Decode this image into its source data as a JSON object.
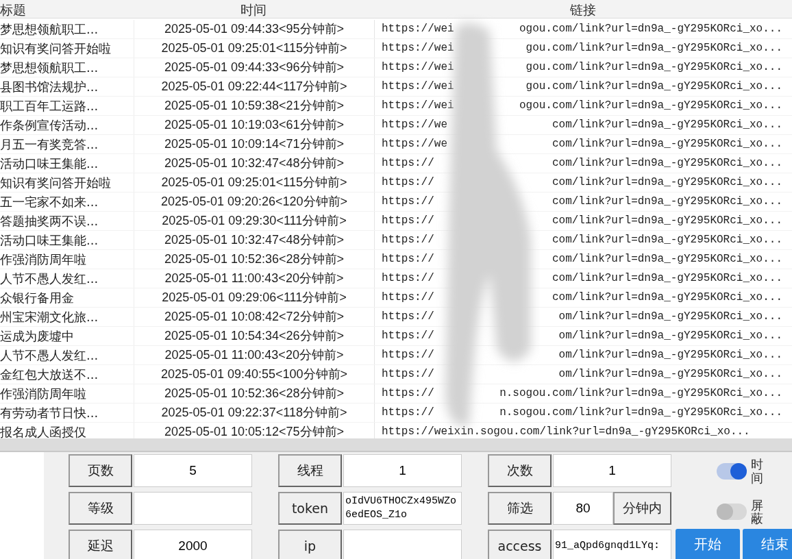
{
  "table": {
    "columns": [
      "标题",
      "时间",
      "链接"
    ],
    "rows": [
      {
        "title": "梦思想领航职工...",
        "time": "2025-05-01 09:44:33<95分钟前>",
        "link_start": "https://wei",
        "link_end": "ogou.com/link?url=dn9a_-gY295KORci_xo..."
      },
      {
        "title": "知识有奖问答开始啦",
        "time": "2025-05-01 09:25:01<115分钟前>",
        "link_start": "https://wei",
        "link_end": "gou.com/link?url=dn9a_-gY295KORci_xo..."
      },
      {
        "title": "梦思想领航职工...",
        "time": "2025-05-01 09:44:33<96分钟前>",
        "link_start": "https://wei",
        "link_end": "gou.com/link?url=dn9a_-gY295KORci_xo..."
      },
      {
        "title": "县图书馆法规护...",
        "time": "2025-05-01 09:22:44<117分钟前>",
        "link_start": "https://wei",
        "link_end": "gou.com/link?url=dn9a_-gY295KORci_xo..."
      },
      {
        "title": "职工百年工运路...",
        "time": "2025-05-01 10:59:38<21分钟前>",
        "link_start": "https://wei",
        "link_end": "ogou.com/link?url=dn9a_-gY295KORci_xo..."
      },
      {
        "title": "作条例宣传活动...",
        "time": "2025-05-01 10:19:03<61分钟前>",
        "link_start": "https://we",
        "link_end": "com/link?url=dn9a_-gY295KORci_xo..."
      },
      {
        "title": "月五一有奖竞答...",
        "time": "2025-05-01 10:09:14<71分钟前>",
        "link_start": "https://we",
        "link_end": "com/link?url=dn9a_-gY295KORci_xo..."
      },
      {
        "title": "活动口味王集能...",
        "time": "2025-05-01 10:32:47<48分钟前>",
        "link_start": "https://",
        "link_end": "com/link?url=dn9a_-gY295KORci_xo..."
      },
      {
        "title": "知识有奖问答开始啦",
        "time": "2025-05-01 09:25:01<115分钟前>",
        "link_start": "https://",
        "link_end": "com/link?url=dn9a_-gY295KORci_xo..."
      },
      {
        "title": "五一宅家不如来...",
        "time": "2025-05-01 09:20:26<120分钟前>",
        "link_start": "https://",
        "link_end": "com/link?url=dn9a_-gY295KORci_xo..."
      },
      {
        "title": "答题抽奖两不误...",
        "time": "2025-05-01 09:29:30<111分钟前>",
        "link_start": "https://",
        "link_end": "com/link?url=dn9a_-gY295KORci_xo..."
      },
      {
        "title": "活动口味王集能...",
        "time": "2025-05-01 10:32:47<48分钟前>",
        "link_start": "https://",
        "link_end": "com/link?url=dn9a_-gY295KORci_xo..."
      },
      {
        "title": "作强消防周年啦",
        "time": "2025-05-01 10:52:36<28分钟前>",
        "link_start": "https://",
        "link_end": "com/link?url=dn9a_-gY295KORci_xo..."
      },
      {
        "title": "人节不愚人发红...",
        "time": "2025-05-01 11:00:43<20分钟前>",
        "link_start": "https://",
        "link_end": "com/link?url=dn9a_-gY295KORci_xo..."
      },
      {
        "title": "众银行备用金",
        "time": "2025-05-01 09:29:06<111分钟前>",
        "link_start": "https://",
        "link_end": "com/link?url=dn9a_-gY295KORci_xo..."
      },
      {
        "title": "州宝宋潮文化旅...",
        "time": "2025-05-01 10:08:42<72分钟前>",
        "link_start": "https://",
        "link_end": "om/link?url=dn9a_-gY295KORci_xo..."
      },
      {
        "title": "运成为废墟中",
        "time": "2025-05-01 10:54:34<26分钟前>",
        "link_start": "https://",
        "link_end": "om/link?url=dn9a_-gY295KORci_xo..."
      },
      {
        "title": "人节不愚人发红...",
        "time": "2025-05-01 11:00:43<20分钟前>",
        "link_start": "https://",
        "link_end": "om/link?url=dn9a_-gY295KORci_xo..."
      },
      {
        "title": "金红包大放送不...",
        "time": "2025-05-01 09:40:55<100分钟前>",
        "link_start": "https://",
        "link_end": "om/link?url=dn9a_-gY295KORci_xo..."
      },
      {
        "title": "作强消防周年啦",
        "time": "2025-05-01 10:52:36<28分钟前>",
        "link_start": "https://",
        "link_end": "n.sogou.com/link?url=dn9a_-gY295KORci_xo..."
      },
      {
        "title": "有劳动者节日快...",
        "time": "2025-05-01 09:22:37<118分钟前>",
        "link_start": "https://",
        "link_end": "n.sogou.com/link?url=dn9a_-gY295KORci_xo..."
      },
      {
        "title": "报名成人函授仅",
        "time": "2025-05-01 10:05:12<75分钟前>",
        "link_start": "https://weixin.sogou.com/link?url=dn9a_-gY295KORci_xo..."
      }
    ]
  },
  "settings": [
    [
      {
        "label": "页数",
        "value": "5"
      },
      {
        "label": "线程",
        "value": "1"
      },
      {
        "label": "次数",
        "value": "1"
      }
    ],
    [
      {
        "label": "等级"
      },
      {
        "label": "token",
        "value": "oIdVU6THOCZx495WZo6edEOS_Z1o"
      },
      {
        "label": "筛选",
        "value": "80",
        "unit": "分钟内"
      }
    ],
    [
      {
        "label": "延迟",
        "value": "2000"
      },
      {
        "label": "ip"
      },
      {
        "label": "access",
        "value": "91_aQpd6gnqd1LYq:"
      }
    ]
  ],
  "toggles": [
    {
      "label": "时间",
      "on": true
    },
    {
      "label": "屏蔽",
      "on": false
    }
  ],
  "buttons": [
    "开始",
    "结束"
  ]
}
